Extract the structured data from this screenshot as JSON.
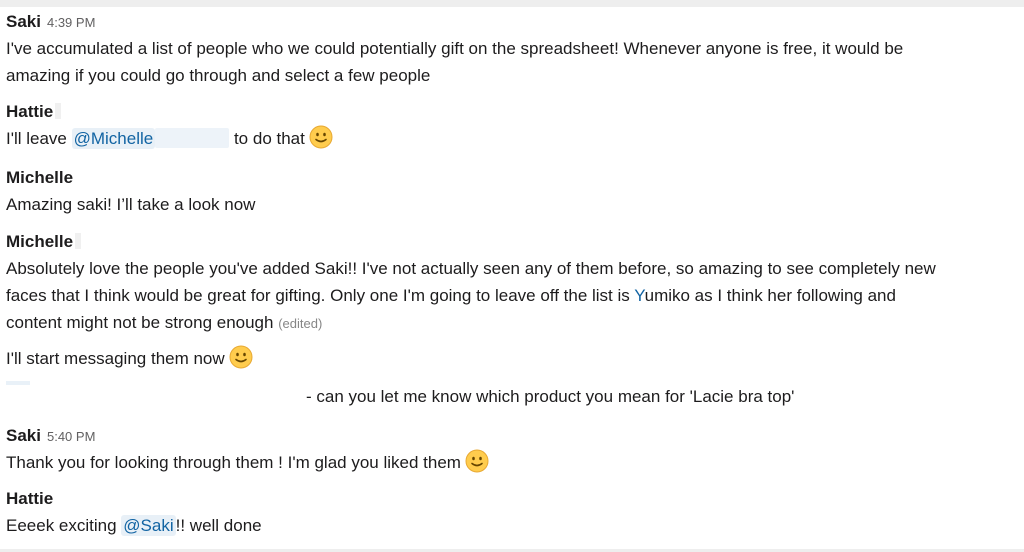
{
  "messages": [
    {
      "author": "Saki",
      "time": "4:39 PM",
      "text_line1": "I've accumulated a list of people who we could potentially gift on the spreadsheet! Whenever anyone is free, it would be",
      "text_line2": "amazing if you could go through and select a few people"
    },
    {
      "author": "Hattie",
      "text_before": "I'll leave ",
      "mention": "@Michelle",
      "text_after": " to do that",
      "emoji": "slightly-smiling-face"
    },
    {
      "author": "Michelle",
      "text": "Amazing saki! I’ll take a look now"
    },
    {
      "author": "Michelle",
      "text_line1": "Absolutely love the people you've added Saki!! I've not actually seen any of them before, so amazing to see completely new",
      "text_line2_before": "faces that I think would be great for gifting. Only one I'm going to leave off the list is ",
      "highlight": "Y",
      "text_line2_after": "umiko as I think her following and",
      "text_line3": "content might not be strong enough",
      "edited": "(edited)",
      "followup": "I'll start messaging them now",
      "followup_emoji": "slightly-smiling-face",
      "indent_text": "- can you let me know which product you mean for 'Lacie bra top'"
    },
    {
      "author": "Saki",
      "time": "5:40 PM",
      "text": "Thank you for looking through them ! I'm glad you liked them",
      "emoji": "slightly-smiling-face"
    },
    {
      "author": "Hattie",
      "text_before": "Eeeek exciting ",
      "mention": "@Saki",
      "text_after": "!! well done"
    }
  ]
}
